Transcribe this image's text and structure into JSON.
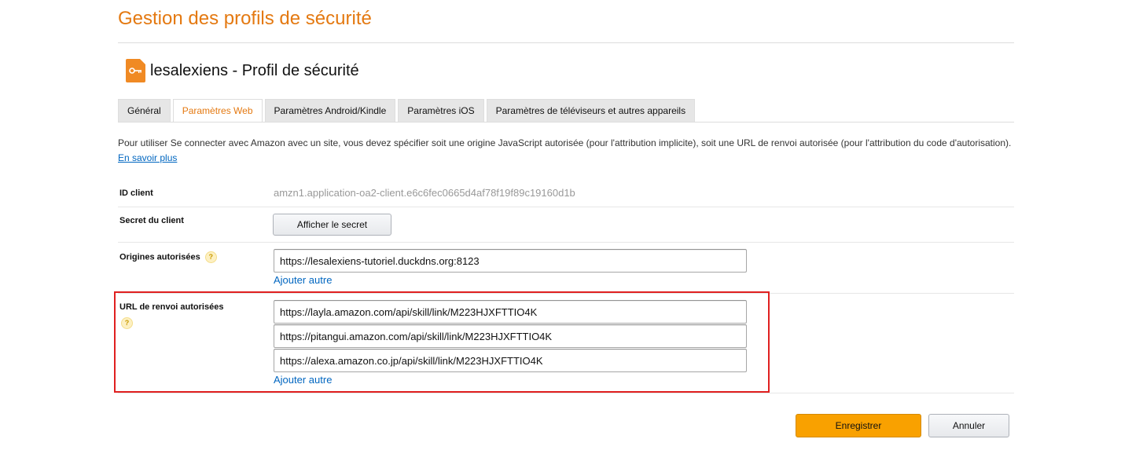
{
  "page": {
    "title": "Gestion des profils de sécurité"
  },
  "profile": {
    "icon": "key-icon",
    "title": "lesalexiens - Profil de sécurité"
  },
  "tabs": [
    {
      "label": "Général",
      "active": false
    },
    {
      "label": "Paramètres Web",
      "active": true
    },
    {
      "label": "Paramètres Android/Kindle",
      "active": false
    },
    {
      "label": "Paramètres iOS",
      "active": false
    },
    {
      "label": "Paramètres de téléviseurs et autres appareils",
      "active": false
    }
  ],
  "intro": {
    "text": "Pour utiliser Se connecter avec Amazon avec un site, vous devez spécifier soit une origine JavaScript autorisée (pour l'attribution implicite), soit une URL de renvoi autorisée (pour l'attribution du code d'autorisation).",
    "link": "En savoir plus"
  },
  "client_id": {
    "label": "ID client",
    "value": "amzn1.application-oa2-client.e6c6fec0665d4af78f19f89c19160d1b"
  },
  "client_secret": {
    "label": "Secret du client",
    "button": "Afficher le secret"
  },
  "origins": {
    "label": "Origines autorisées",
    "help": "?",
    "values": [
      "https://lesalexiens-tutoriel.duckdns.org:8123"
    ],
    "add_link": "Ajouter autre"
  },
  "redirects": {
    "label": "URL de renvoi autorisées",
    "help": "?",
    "values": [
      "https://layla.amazon.com/api/skill/link/M223HJXFTTIO4K",
      "https://pitangui.amazon.com/api/skill/link/M223HJXFTTIO4K",
      "https://alexa.amazon.co.jp/api/skill/link/M223HJXFTTIO4K"
    ],
    "add_link": "Ajouter autre"
  },
  "actions": {
    "save": "Enregistrer",
    "cancel": "Annuler"
  },
  "colors": {
    "title": "#e47911",
    "save_button": "#f9a100",
    "link": "#0066c0",
    "highlight_border": "#e02020"
  }
}
